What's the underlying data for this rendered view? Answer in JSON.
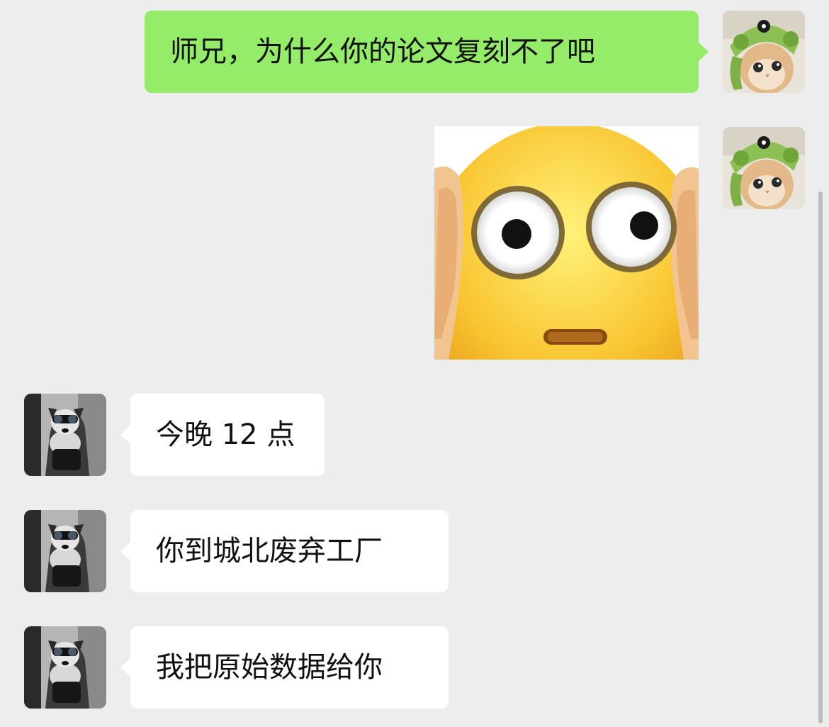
{
  "messages": [
    {
      "sender": "me",
      "type": "text",
      "text": "师兄，为什么你的论文复刻不了吧"
    },
    {
      "sender": "me",
      "type": "sticker",
      "sticker": "wide-eyed-face-emoji"
    },
    {
      "sender": "senior",
      "type": "text",
      "text": "今晚 12 点"
    },
    {
      "sender": "senior",
      "type": "text",
      "text": "你到城北废弃工厂"
    },
    {
      "sender": "senior",
      "type": "text",
      "text": "我把原始数据给你"
    }
  ],
  "avatars": {
    "me": "cat-in-frog-hat-avatar",
    "senior": "dog-with-goggles-avatar"
  },
  "colors": {
    "background": "#ededed",
    "sent_bubble": "#95ec69",
    "received_bubble": "#ffffff",
    "text": "#111111"
  }
}
